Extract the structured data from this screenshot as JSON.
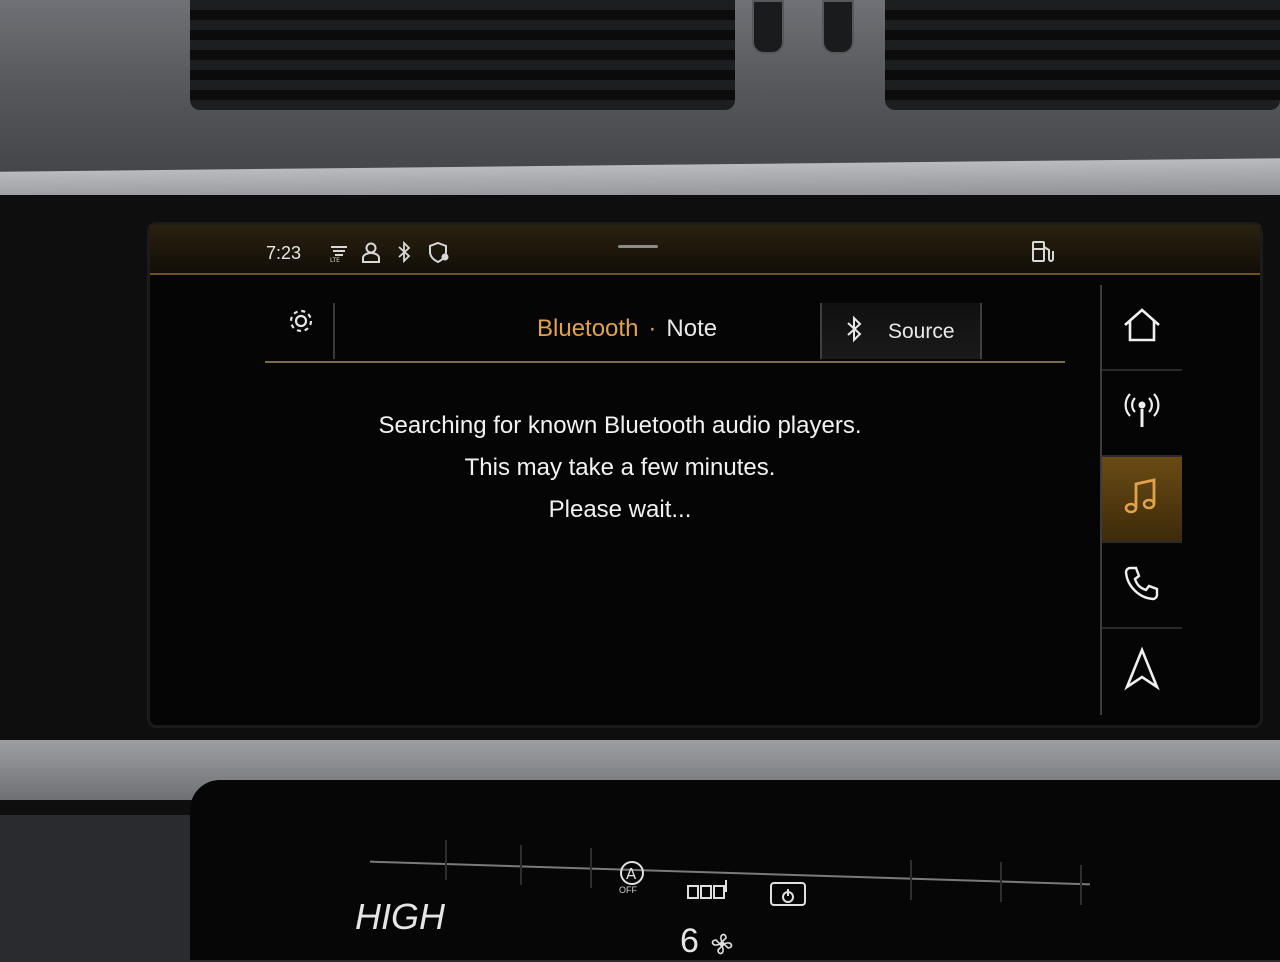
{
  "status_bar": {
    "time": "7:23",
    "icons": [
      "lte-signal-icon",
      "user-profile-icon",
      "bluetooth-icon",
      "security-shield-icon"
    ],
    "right_icon": "fuel-pump-icon"
  },
  "header": {
    "settings_icon": "gear-icon",
    "title_source": "Bluetooth",
    "title_separator": "·",
    "title_device": "Note",
    "source_icon": "bluetooth-icon",
    "source_label": "Source"
  },
  "message": {
    "line1": "Searching for known Bluetooth audio players.",
    "line2": "This may take a few minutes.",
    "line3": "Please wait..."
  },
  "nav_rail": {
    "items": [
      {
        "name": "home",
        "icon": "home-icon",
        "active": false
      },
      {
        "name": "radio",
        "icon": "radio-broadcast-icon",
        "active": false
      },
      {
        "name": "media",
        "icon": "music-note-icon",
        "active": true
      },
      {
        "name": "phone",
        "icon": "phone-icon",
        "active": false
      },
      {
        "name": "navigation",
        "icon": "navigation-arrow-icon",
        "active": false
      }
    ]
  },
  "climate": {
    "temperature_label": "HIGH",
    "auto_off_label": "OFF",
    "fan_level": "6"
  },
  "colors": {
    "accent": "#e2a24d",
    "active_tab": "#6a4b14",
    "screen_bg": "#050505",
    "text": "#f2f2f2"
  }
}
